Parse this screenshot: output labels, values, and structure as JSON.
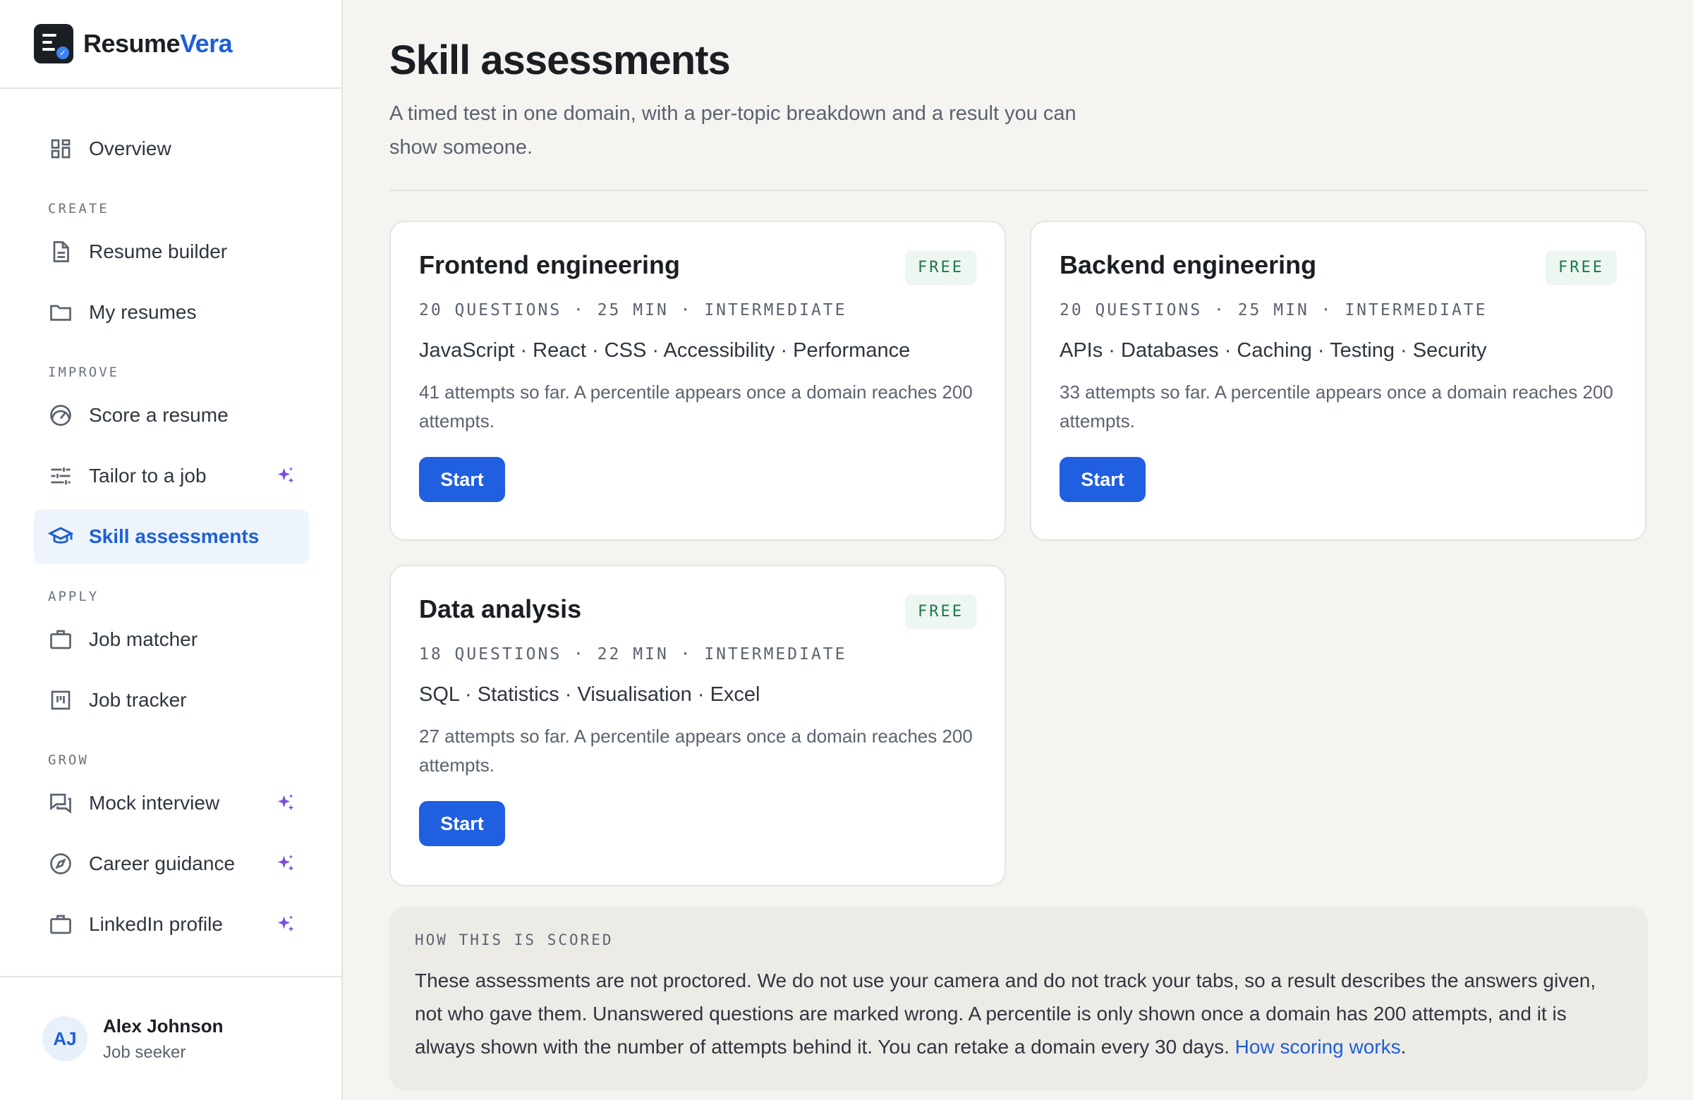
{
  "brand": {
    "name_part1": "Resume",
    "name_part2": "Vera"
  },
  "sidebar": {
    "overview": "Overview",
    "sections": {
      "create": "CREATE",
      "improve": "IMPROVE",
      "apply": "APPLY",
      "grow": "GROW"
    },
    "items": {
      "resume_builder": "Resume builder",
      "my_resumes": "My resumes",
      "score_resume": "Score a resume",
      "tailor_job": "Tailor to a job",
      "skill_assessments": "Skill assessments",
      "job_matcher": "Job matcher",
      "job_tracker": "Job tracker",
      "mock_interview": "Mock interview",
      "career_guidance": "Career guidance",
      "linkedin_profile": "LinkedIn profile"
    },
    "active_item": "Skill assessments",
    "ai_marked_icon": "sparkle-icon",
    "accent_color": "#1d5fd6",
    "sparkle_color": "#7c4ddf"
  },
  "user": {
    "initials": "AJ",
    "name": "Alex Johnson",
    "role": "Job seeker"
  },
  "main": {
    "title": "Skill assessments",
    "subtitle": "A timed test in one domain, with a per-topic breakdown and a result you can show someone."
  },
  "cards": [
    {
      "title": "Frontend engineering",
      "badge": "FREE",
      "meta": "20 QUESTIONS · 25 MIN · INTERMEDIATE",
      "topics": "JavaScript · React · CSS · Accessibility · Performance",
      "attempts": "41 attempts so far. A percentile appears once a domain reaches 200 attempts.",
      "button": "Start"
    },
    {
      "title": "Backend engineering",
      "badge": "FREE",
      "meta": "20 QUESTIONS · 25 MIN · INTERMEDIATE",
      "topics": "APIs · Databases · Caching · Testing · Security",
      "attempts": "33 attempts so far. A percentile appears once a domain reaches 200 attempts.",
      "button": "Start"
    },
    {
      "title": "Data analysis",
      "badge": "FREE",
      "meta": "18 QUESTIONS · 22 MIN · INTERMEDIATE",
      "topics": "SQL · Statistics · Visualisation · Excel",
      "attempts": "27 attempts so far. A percentile appears once a domain reaches 200 attempts.",
      "button": "Start"
    }
  ],
  "scoring": {
    "label": "HOW THIS IS SCORED",
    "text": "These assessments are not proctored. We do not use your camera and do not track your tabs, so a result describes the answers given, not who gave them. Unanswered questions are marked wrong. A percentile is only shown once a domain has 200 attempts, and it is always shown with the number of attempts behind it. You can retake a domain every 30 days.",
    "link": "How scoring works",
    "end": "."
  },
  "colors": {
    "primary_button": "#1f5fe0",
    "badge_text": "#1b7a4a",
    "badge_bg": "#eef6f1",
    "page_bg": "#f5f4f1"
  }
}
